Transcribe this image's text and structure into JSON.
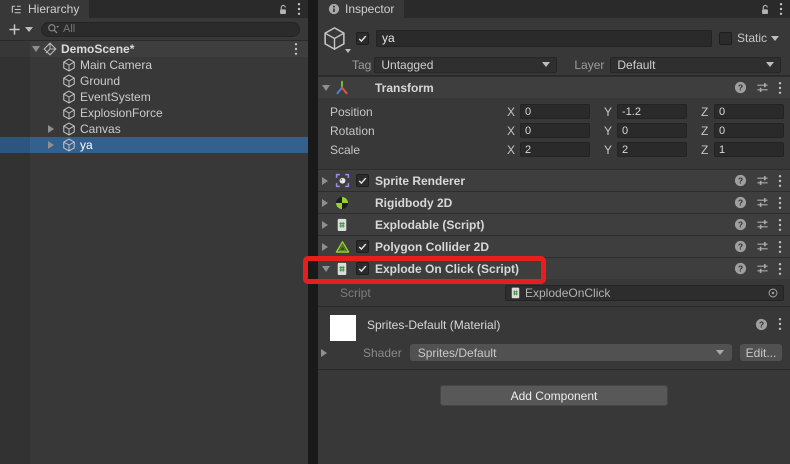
{
  "hierarchy": {
    "tab_label": "Hierarchy",
    "search_placeholder": "All",
    "scene_name": "DemoScene*",
    "items": [
      {
        "label": "Main Camera",
        "arrow": false,
        "selected": false
      },
      {
        "label": "Ground",
        "arrow": false,
        "selected": false
      },
      {
        "label": "EventSystem",
        "arrow": false,
        "selected": false
      },
      {
        "label": "ExplosionForce",
        "arrow": false,
        "selected": false
      },
      {
        "label": "Canvas",
        "arrow": true,
        "selected": false
      },
      {
        "label": "ya",
        "arrow": true,
        "selected": true
      }
    ]
  },
  "inspector": {
    "tab_label": "Inspector",
    "game_object": {
      "name": "ya",
      "active": true,
      "static_label": "Static",
      "tag_label": "Tag",
      "tag_value": "Untagged",
      "layer_label": "Layer",
      "layer_value": "Default"
    },
    "transform": {
      "title": "Transform",
      "axes": [
        "X",
        "Y",
        "Z"
      ],
      "rows": [
        {
          "label": "Position",
          "values": [
            "0",
            "-1.2",
            "0"
          ]
        },
        {
          "label": "Rotation",
          "values": [
            "0",
            "0",
            "0"
          ]
        },
        {
          "label": "Scale",
          "values": [
            "2",
            "2",
            "1"
          ]
        }
      ]
    },
    "components": [
      {
        "title": "Sprite Renderer",
        "icon": "sprite-renderer",
        "has_checkbox": true,
        "checked": true,
        "expanded": false,
        "highlighted": false
      },
      {
        "title": "Rigidbody 2D",
        "icon": "rigidbody2d",
        "has_checkbox": false,
        "checked": false,
        "expanded": false,
        "highlighted": false
      },
      {
        "title": "Explodable (Script)",
        "icon": "script",
        "has_checkbox": false,
        "checked": false,
        "expanded": false,
        "highlighted": false
      },
      {
        "title": "Polygon Collider 2D",
        "icon": "polygon-collider",
        "has_checkbox": true,
        "checked": true,
        "expanded": false,
        "highlighted": false
      },
      {
        "title": "Explode On Click (Script)",
        "icon": "script",
        "has_checkbox": true,
        "checked": true,
        "expanded": true,
        "highlighted": true
      }
    ],
    "script_field": {
      "label": "Script",
      "value": "ExplodeOnClick"
    },
    "material": {
      "title": "Sprites-Default (Material)",
      "shader_label": "Shader",
      "shader_value": "Sprites/Default",
      "edit_button_label": "Edit..."
    },
    "add_component_label": "Add Component"
  },
  "colors": {
    "selection_blue": "#33608D",
    "annotation_red": "#E71E1E",
    "physics_green": "#95D32C",
    "script_green": "#3F8F3F",
    "sprite_purple": "#9B8CEE"
  }
}
